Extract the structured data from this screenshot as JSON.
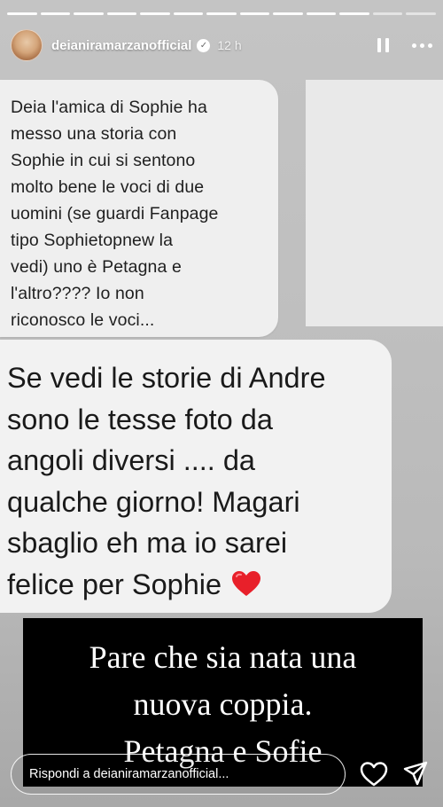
{
  "story": {
    "segments_total": 13,
    "segments_done": 11,
    "header": {
      "username": "deianiramarzanofficial",
      "verified_mark": "✓",
      "time": "12 h",
      "icons": [
        "pause-icon",
        "more-icon"
      ]
    },
    "message1": {
      "lines": [
        "Deia l'amica di Sophie ha",
        "messo una storia con",
        "Sophie in cui si sentono",
        "molto bene le voci di due",
        "uomini (se guardi Fanpage",
        "tipo Sophietopnew la",
        "vedi) uno è Petagna e",
        "l'altro???? Io non",
        "riconosco le voci..."
      ]
    },
    "message2": {
      "lines": [
        "Se vedi le storie di Andre",
        "sono le tesse foto da",
        "angoli diversi .... da",
        "qualche giorno! Magari",
        "sbaglio eh ma io sarei",
        "felice per Sophie"
      ],
      "emoji_icon": "red-heart-icon",
      "heart_color": "#e8202a"
    },
    "caption": {
      "lines": [
        "Pare che sia nata una",
        "nuova coppia.",
        "Petagna e Sofie"
      ]
    },
    "reply": {
      "placeholder": "Rispondi a deianiramarzanofficial..."
    },
    "actions": [
      "heart-icon",
      "send-icon"
    ]
  }
}
